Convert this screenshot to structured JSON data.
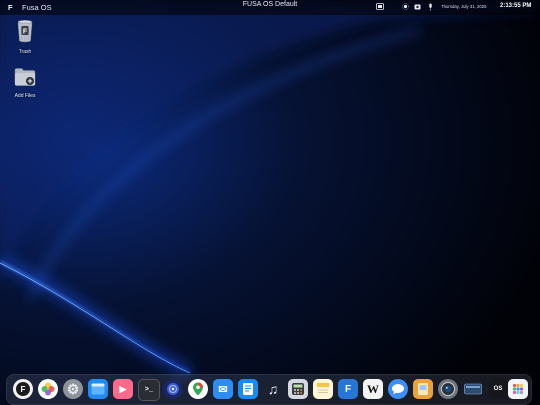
{
  "menubar": {
    "logo": "F",
    "app_name": "Fusa OS",
    "center_title": "FUSA OS Default",
    "date": "Thursday, July 31, 2025",
    "time": "2:13:55 PM"
  },
  "desktop_icons": {
    "trash": {
      "label": "Trash",
      "icon": "trash-icon"
    },
    "add_files": {
      "label": "Add Files",
      "icon": "folder-add-icon"
    }
  },
  "dock": {
    "items": [
      {
        "name": "fusa-launcher",
        "glyph": "F"
      },
      {
        "name": "photos",
        "glyph": ""
      },
      {
        "name": "settings",
        "glyph": "⚙"
      },
      {
        "name": "files",
        "glyph": ""
      },
      {
        "name": "media-player",
        "glyph": "▶"
      },
      {
        "name": "terminal",
        "glyph": ">_"
      },
      {
        "name": "browser",
        "glyph": ""
      },
      {
        "name": "maps",
        "glyph": ""
      },
      {
        "name": "mail",
        "glyph": "✉"
      },
      {
        "name": "app-store",
        "glyph": ""
      },
      {
        "name": "music",
        "glyph": "♫"
      },
      {
        "name": "calculator",
        "glyph": ""
      },
      {
        "name": "notes",
        "glyph": ""
      },
      {
        "name": "text-editor",
        "glyph": "F"
      },
      {
        "name": "wikipedia",
        "glyph": "W"
      },
      {
        "name": "messages",
        "glyph": ""
      },
      {
        "name": "documents",
        "glyph": ""
      },
      {
        "name": "camera",
        "glyph": ""
      },
      {
        "name": "disk",
        "glyph": ""
      },
      {
        "name": "os-info",
        "glyph": "OS"
      },
      {
        "name": "app-grid",
        "glyph": ""
      }
    ]
  },
  "colors": {
    "accent": "#2d6cff",
    "wallpaper_dark": "#02040c",
    "glow": "#1e5cff"
  }
}
